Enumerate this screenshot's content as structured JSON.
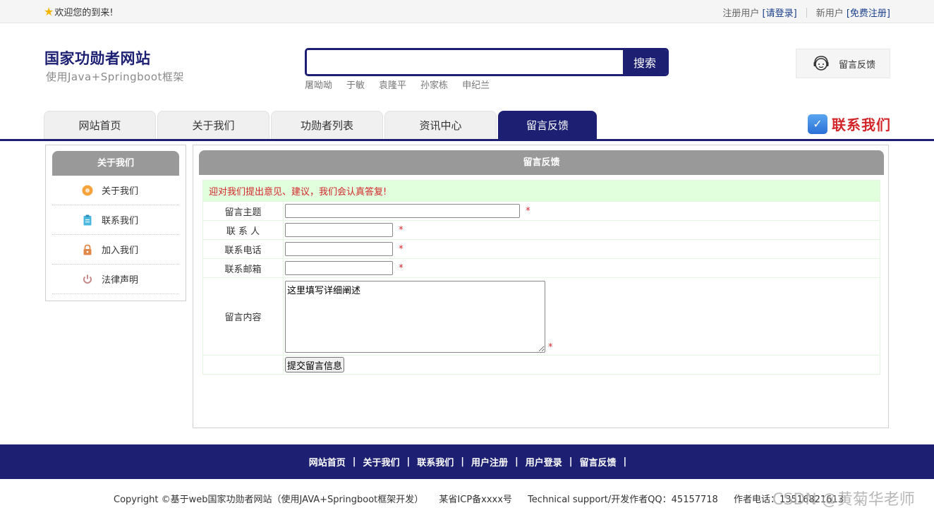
{
  "topbar": {
    "welcome": "欢迎您的到来!",
    "registered_prefix": "注册用户",
    "login_link": "[请登录]",
    "new_prefix": "新用户",
    "register_link": "[免费注册]"
  },
  "header": {
    "title": "国家功勋者网站",
    "subtitle": "使用Java+Springboot框架",
    "search_button": "搜索",
    "search_value": "",
    "hot_words": [
      "屠呦呦",
      "于敏",
      "袁隆平",
      "孙家栋",
      "申纪兰"
    ],
    "feedback_label": "留言反馈"
  },
  "nav": {
    "tabs": [
      "网站首页",
      "关于我们",
      "功勋者列表",
      "资讯中心",
      "留言反馈"
    ],
    "active": "留言反馈",
    "contact_label": "联系我们"
  },
  "sidebar": {
    "title": "关于我们",
    "items": [
      {
        "label": "关于我们",
        "icon": "about-icon"
      },
      {
        "label": "联系我们",
        "icon": "clipboard-icon"
      },
      {
        "label": "加入我们",
        "icon": "lock-icon"
      },
      {
        "label": "法律声明",
        "icon": "power-icon"
      }
    ]
  },
  "main": {
    "title": "留言反馈",
    "notice": "迎对我们提出意见、建议，我们会认真答复!",
    "fields": {
      "subject_label": "留言主题",
      "contact_label": "联 系 人",
      "phone_label": "联系电话",
      "email_label": "联系邮箱",
      "content_label": "留言内容",
      "content_value": "这里填写详细阐述",
      "required_mark": "*"
    },
    "submit_label": "提交留言信息"
  },
  "footer": {
    "links": [
      "网站首页",
      "关于我们",
      "联系我们",
      "用户注册",
      "用户登录",
      "留言反馈"
    ],
    "separator": "|",
    "copyright": "Copyright ©基于web国家功勋者网站（使用JAVA+Springboot框架开发）",
    "icp": "某省ICP备xxxx号",
    "support": "Technical support/开发作者QQ：45157718",
    "phone": "作者电话：13516821613",
    "watermark": "CSDN @黄菊华老师"
  },
  "colors": {
    "brand": "#1c1f72",
    "accent_red": "#d2262a",
    "notice_bg": "#e1ffdc"
  }
}
